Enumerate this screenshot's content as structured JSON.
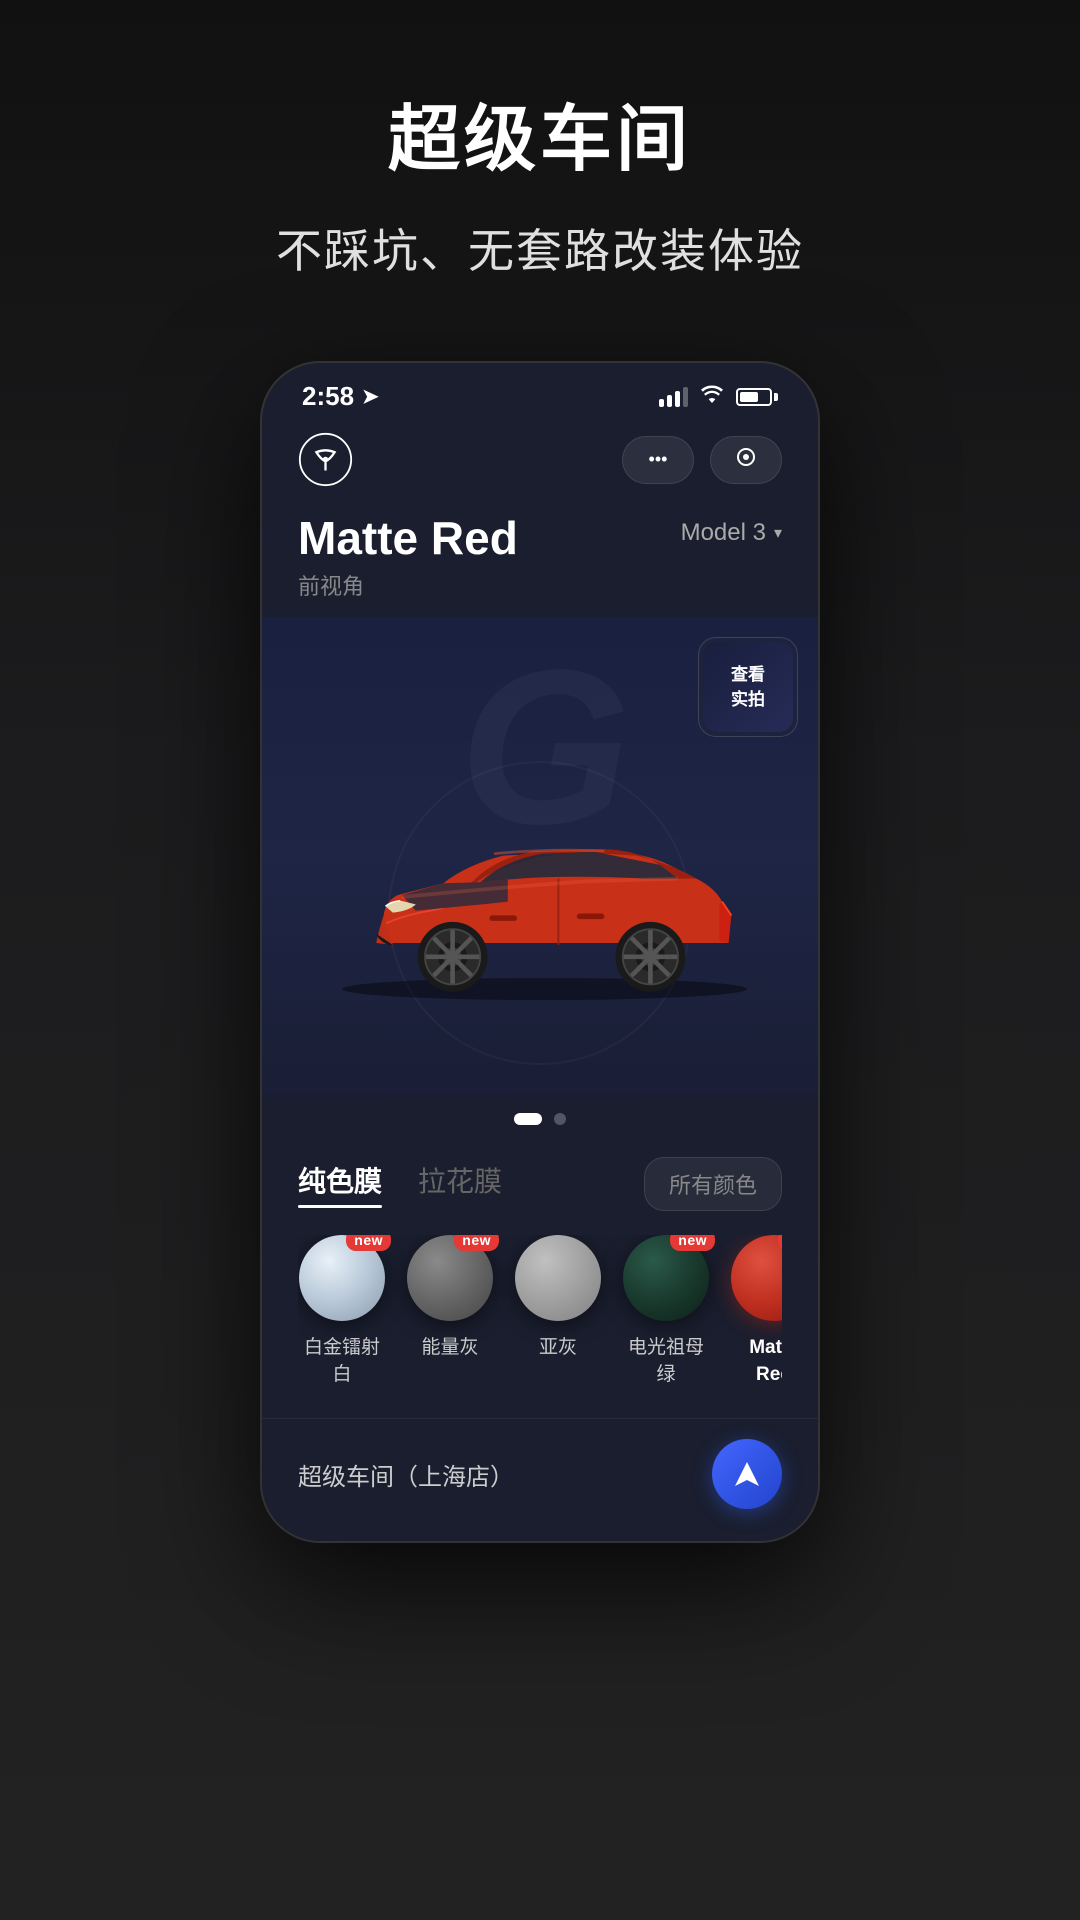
{
  "page": {
    "hero_title": "超级车间",
    "hero_subtitle": "不踩坑、无套路改装体验"
  },
  "status_bar": {
    "time": "2:58",
    "signal": "signal-icon"
  },
  "app_header": {
    "logo": "saturn-logo-icon",
    "more_btn": "•••",
    "scan_btn": "scan-icon"
  },
  "car_view": {
    "car_name": "Matte Red",
    "view_label": "前视角",
    "model_selector": "Model 3",
    "photos_btn_label": "查看\n实拍",
    "brand_watermark": "G"
  },
  "pagination": {
    "dots": [
      {
        "active": true
      },
      {
        "active": false
      }
    ]
  },
  "color_tabs": {
    "tabs": [
      {
        "label": "纯色膜",
        "active": true
      },
      {
        "label": "拉花膜",
        "active": false
      }
    ],
    "all_colors_btn": "所有颜色"
  },
  "color_swatches": [
    {
      "id": "white-gold",
      "label": "白金镭射\n白",
      "is_new": true,
      "selected": false
    },
    {
      "id": "energy-gray",
      "label": "能量灰",
      "is_new": true,
      "selected": false
    },
    {
      "id": "sub-gray",
      "label": "亚灰",
      "is_new": false,
      "selected": false
    },
    {
      "id": "electric-green",
      "label": "电光祖母\n绿",
      "is_new": true,
      "selected": false
    },
    {
      "id": "matte-red",
      "label": "Matte\nRed",
      "is_new": true,
      "selected": true
    }
  ],
  "bottom_bar": {
    "shop_name": "超级车间（上海店）",
    "nav_icon": "navigation-icon"
  }
}
